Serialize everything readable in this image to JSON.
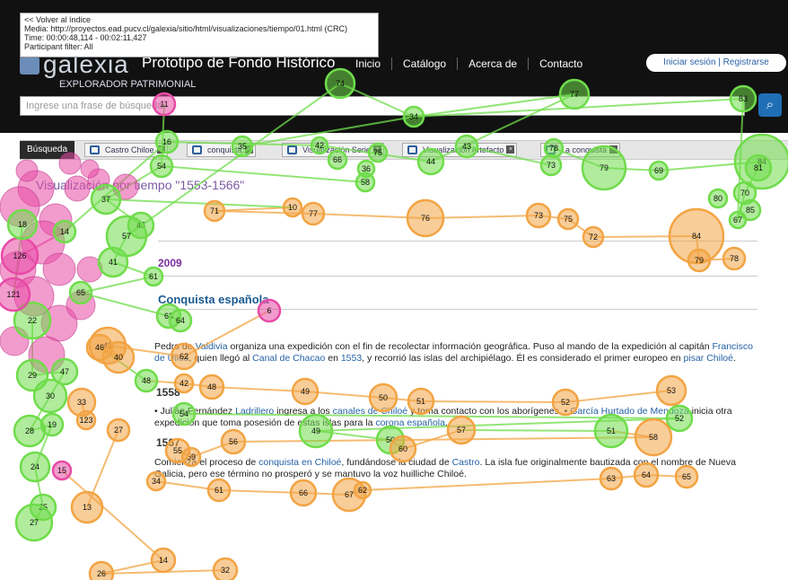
{
  "overlay": {
    "back_link": "<< Volver al índice",
    "media_line": "Media: http://proyectos.ead.pucv.cl/galexia/sitio/html/visualizaciones/tiempo/01.html (CRC)",
    "time_line": "Time: 00:00:48,114 - 00:02:11,427",
    "filter_line": "Participant filter: All"
  },
  "header": {
    "logo_text": "galexia",
    "site_title": "Prototipo de Fondo Histórico",
    "nav": [
      "Inicio",
      "Catálogo",
      "Acerca de",
      "Contacto"
    ],
    "login": "Iniciar sesión | Registrarse",
    "explorer_label": "EXPLORADOR PATRIMONIAL",
    "search_placeholder": "Ingrese una frase de búsqueda"
  },
  "breadcrumb": {
    "first": "Búsqueda",
    "items": [
      "Castro Chiloe",
      "conquista",
      "Visualización Serie",
      "Visualización Artefacto",
      "La conquista"
    ]
  },
  "content": {
    "heading": "Visualización por tiempo \"1553-1566\"",
    "year_a": "2009",
    "conquista_heading": "Conquista española",
    "para1_a": "Pedro de ",
    "para1_link1": "Valdivia",
    "para1_b": " organiza una expedición con el fin de recolectar información geográfica. Puso al mando de la expedición al capitán ",
    "para1_link2": "Francisco de Ulloa",
    "para1_c": ", quien llegó al ",
    "para1_link3": "Canal de Chacao",
    "para1_d": " en ",
    "para1_link4": "1553",
    "para1_e": ", y recorrió las islas del archipiélago. Él es considerado el primer europeo en ",
    "para1_link5": "pisar Chiloé",
    "para1_f": ".",
    "year_b": "1558",
    "para2_a": "• Julián Fernández ",
    "para2_link1": "Ladrillero",
    "para2_b": " ingresa a los ",
    "para2_link2": "canales de Chiloé",
    "para2_c": " y toma contacto con los aborígenes. • ",
    "para2_link3": "García Hurtado de Mendoza",
    "para2_d": " inicia otra expedición que toma posesión de estas islas para la ",
    "para2_link4": "corona española",
    "para2_e": ".",
    "year_c": "1567",
    "para3_a": "Comienza el proceso de ",
    "para3_link1": "conquista en Chiloé",
    "para3_b": ", fundándose la ciudad de ",
    "para3_link2": "Castro",
    "para3_c": ". La isla fue originalmente bautizada con el nombre de Nueva Galicia, pero ese término no prosperó y se mantuvo la voz huilliche Chiloé."
  },
  "gaze": {
    "colors": {
      "green": "#6fdc4a",
      "orange": "#f2a443",
      "pink": "#e84aa6"
    },
    "fixations": [
      {
        "n": "74",
        "c": "green"
      },
      {
        "n": "77",
        "c": "green"
      },
      {
        "n": "34",
        "c": "green"
      },
      {
        "n": "83",
        "c": "green"
      },
      {
        "n": "11",
        "c": "pink"
      },
      {
        "n": "35",
        "c": "green"
      },
      {
        "n": "42",
        "c": "green"
      },
      {
        "n": "66",
        "c": "green"
      },
      {
        "n": "75",
        "c": "green"
      },
      {
        "n": "43",
        "c": "green"
      },
      {
        "n": "44",
        "c": "green"
      },
      {
        "n": "78",
        "c": "green"
      },
      {
        "n": "73",
        "c": "green"
      },
      {
        "n": "79",
        "c": "green"
      },
      {
        "n": "69",
        "c": "green"
      },
      {
        "n": "84",
        "c": "green"
      },
      {
        "n": "81",
        "c": "green"
      },
      {
        "n": "70",
        "c": "green"
      },
      {
        "n": "80",
        "c": "green"
      },
      {
        "n": "85",
        "c": "green"
      },
      {
        "n": "67",
        "c": "green"
      },
      {
        "n": "36",
        "c": "green"
      },
      {
        "n": "58",
        "c": "green"
      },
      {
        "n": "54",
        "c": "green"
      },
      {
        "n": "10",
        "c": "orange"
      },
      {
        "n": "71",
        "c": "orange"
      },
      {
        "n": "77",
        "c": "orange"
      },
      {
        "n": "76",
        "c": "orange"
      },
      {
        "n": "73",
        "c": "orange"
      },
      {
        "n": "75",
        "c": "orange"
      },
      {
        "n": "72",
        "c": "orange"
      },
      {
        "n": "84",
        "c": "orange"
      },
      {
        "n": "79",
        "c": "orange"
      },
      {
        "n": "78",
        "c": "orange"
      },
      {
        "n": "37",
        "c": "green"
      },
      {
        "n": "45",
        "c": "green"
      },
      {
        "n": "57",
        "c": "green"
      },
      {
        "n": "41",
        "c": "green"
      },
      {
        "n": "61",
        "c": "green"
      },
      {
        "n": "65",
        "c": "green"
      },
      {
        "n": "63",
        "c": "green"
      },
      {
        "n": "64",
        "c": "green"
      },
      {
        "n": "6",
        "c": "pink"
      },
      {
        "n": "62",
        "c": "orange"
      },
      {
        "n": "43",
        "c": "orange"
      },
      {
        "n": "40",
        "c": "orange"
      },
      {
        "n": "46",
        "c": "orange"
      },
      {
        "n": "48",
        "c": "green"
      },
      {
        "n": "42",
        "c": "orange"
      },
      {
        "n": "48",
        "c": "orange"
      },
      {
        "n": "49",
        "c": "orange"
      },
      {
        "n": "50",
        "c": "orange"
      },
      {
        "n": "51",
        "c": "orange"
      },
      {
        "n": "52",
        "c": "orange"
      },
      {
        "n": "53",
        "c": "orange"
      },
      {
        "n": "54",
        "c": "green"
      },
      {
        "n": "52",
        "c": "green"
      },
      {
        "n": "49",
        "c": "green"
      },
      {
        "n": "50",
        "c": "green"
      },
      {
        "n": "60",
        "c": "orange"
      },
      {
        "n": "57",
        "c": "orange"
      },
      {
        "n": "51",
        "c": "green"
      },
      {
        "n": "58",
        "c": "orange"
      },
      {
        "n": "56",
        "c": "orange"
      },
      {
        "n": "59",
        "c": "orange"
      },
      {
        "n": "55",
        "c": "orange"
      },
      {
        "n": "34",
        "c": "orange"
      },
      {
        "n": "61",
        "c": "orange"
      },
      {
        "n": "66",
        "c": "orange"
      },
      {
        "n": "67",
        "c": "orange"
      },
      {
        "n": "62",
        "c": "orange"
      },
      {
        "n": "63",
        "c": "orange"
      },
      {
        "n": "64",
        "c": "orange"
      },
      {
        "n": "65",
        "c": "orange"
      },
      {
        "n": "27",
        "c": "orange"
      },
      {
        "n": "13",
        "c": "orange"
      },
      {
        "n": "33",
        "c": "orange"
      },
      {
        "n": "123",
        "c": "orange"
      },
      {
        "n": "22",
        "c": "green"
      },
      {
        "n": "29",
        "c": "green"
      },
      {
        "n": "47",
        "c": "green"
      },
      {
        "n": "30",
        "c": "green"
      },
      {
        "n": "28",
        "c": "green"
      },
      {
        "n": "19",
        "c": "green"
      },
      {
        "n": "24",
        "c": "green"
      },
      {
        "n": "25",
        "c": "green"
      },
      {
        "n": "27",
        "c": "green"
      },
      {
        "n": "15",
        "c": "pink"
      },
      {
        "n": "14",
        "c": "orange"
      },
      {
        "n": "26",
        "c": "orange"
      },
      {
        "n": "32",
        "c": "orange"
      },
      {
        "n": "16",
        "c": "green"
      },
      {
        "n": "14",
        "c": "green"
      },
      {
        "n": "126",
        "c": "pink"
      },
      {
        "n": "121",
        "c": "pink"
      },
      {
        "n": "18",
        "c": "green"
      }
    ]
  }
}
